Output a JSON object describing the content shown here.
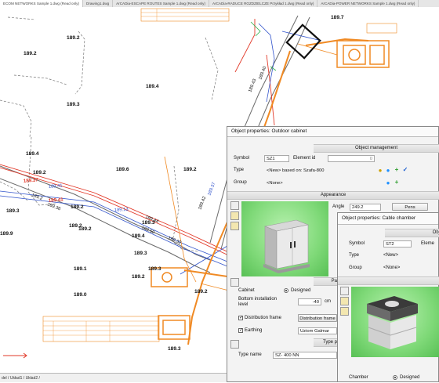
{
  "tabs": [
    {
      "label": "ECOM NETWORKS Sample 1.dwg (Read only)",
      "active": true
    },
    {
      "label": "Drawing1.dwg"
    },
    {
      "label": "ArCADia-ESCAPE ROUTES Sample 1.dwg (Read only)"
    },
    {
      "label": "ArCADia-RADUCE ROZDZIELCZE Przykład 1.dwg (Read only)"
    },
    {
      "label": "ArCADia-POWER NETWORKS Sample 1.dwg (Read only)"
    }
  ],
  "drawing": {
    "elevations": [
      "189.7",
      "189.2",
      "189.2",
      "189.4",
      "189.3",
      "189.4",
      "189.2",
      "189.6",
      "189.2",
      "189.3",
      "189.2",
      "189.3",
      "189.1",
      "189.2",
      "189.0",
      "189.3",
      "189.3",
      "189.4",
      "189.2",
      "189.2",
      "189.3",
      "189.2",
      "189.9"
    ],
    "line_labels": [
      "189.41",
      "189.13",
      "189.36",
      "189.44",
      "189.2",
      "189.50",
      "189.32",
      "189.42",
      "189.37",
      "189.43",
      "189.40"
    ],
    "red_labels": [
      "189.37",
      "189.41"
    ]
  },
  "object_properties": {
    "title": "Object properties: Outdoor cabinet",
    "sections": {
      "management": "Object management",
      "appearance": "Appearance",
      "parameters": "Pa",
      "type": "Type p"
    },
    "symbol_label": "Symbol",
    "symbol_value": "SZ1",
    "element_id_label": "Element id",
    "element_id_value": "0",
    "type_label": "Type",
    "type_value": "<New> based on: Szafa-800",
    "group_label": "Group",
    "group_value": "<None>",
    "angle_label": "Angle",
    "angle_value": "249.2",
    "pens_button": "Pens",
    "cabinet_label": "Cabinet",
    "cabinet_option": "Designed",
    "bottom_level_label": "Bottom installation level",
    "bottom_level_value": "-40",
    "bottom_level_unit": "cm",
    "distribution_frame_label": "Distribution frame",
    "distribution_frame_button": "Distribution frame",
    "earthing_label": "Earthing",
    "earthing_value": "Uziom Galmar",
    "type_name_label": "Type name",
    "type_name_value": "SZ- 400 NN"
  },
  "cable_chamber": {
    "title": "Object properties: Cable chamber",
    "section_short": "Obj",
    "symbol_label": "Symbol",
    "symbol_value": "ST2",
    "element_short": "Eleme",
    "type_label": "Type",
    "type_value": "<New>",
    "group_label": "Group",
    "group_value": "<None>",
    "chamber_label": "Chamber",
    "chamber_option": "Designed"
  },
  "status_bar": {
    "text": "del  /  Układ1  /  Układ2  /"
  }
}
